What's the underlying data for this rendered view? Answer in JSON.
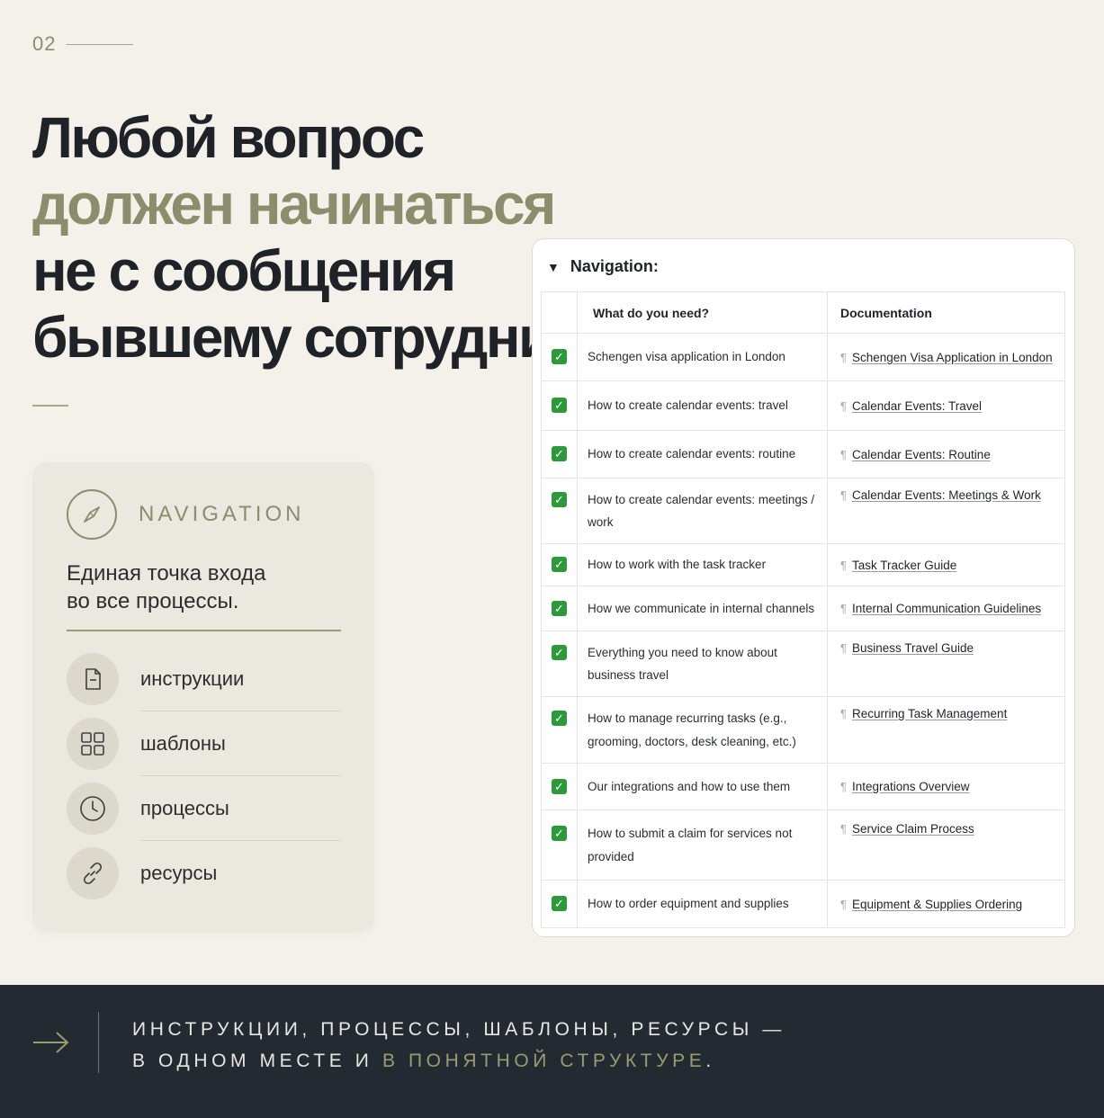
{
  "page_number": "02",
  "headline": {
    "line1": "Любой вопрос",
    "line2": "должен начинаться",
    "line3": "не с сообщения",
    "line4": "бывшему сотруднику."
  },
  "card": {
    "icon": "compass-icon",
    "title": "NAVIGATION",
    "subtitle_line1": "Единая точка входа",
    "subtitle_line2": "во все процессы.",
    "items": [
      {
        "icon": "document-icon",
        "label": "инструкции"
      },
      {
        "icon": "grid-icon",
        "label": "шаблоны"
      },
      {
        "icon": "clock-icon",
        "label": "процессы"
      },
      {
        "icon": "link-icon",
        "label": "ресурсы"
      }
    ]
  },
  "panel": {
    "title": "Navigation:",
    "columns": [
      "What do you need?",
      "Documentation"
    ],
    "rows": [
      {
        "question": "Schengen visa application in London",
        "doc": "Schengen Visa Application in London"
      },
      {
        "question": "How to create calendar events: travel",
        "doc": "Calendar Events: Travel"
      },
      {
        "question": "How to create calendar events: routine",
        "doc": "Calendar Events: Routine"
      },
      {
        "question": "How to create calendar events: meetings / work",
        "doc": "Calendar Events: Meetings & Work"
      },
      {
        "question": "How to work with the task tracker",
        "doc": "Task Tracker Guide"
      },
      {
        "question": "How we communicate in internal channels",
        "doc": "Internal Communication Guidelines"
      },
      {
        "question": "Everything you need to know about business travel",
        "doc": "Business Travel Guide"
      },
      {
        "question": "How to manage recurring tasks (e.g., grooming, doctors, desk cleaning, etc.)",
        "doc": "Recurring Task Management"
      },
      {
        "question": "Our integrations and how to use them",
        "doc": "Integrations Overview"
      },
      {
        "question": "How to submit a claim for services not provided",
        "doc": "Service Claim Process"
      },
      {
        "question": "How to order equipment and supplies",
        "doc": "Equipment & Supplies Ordering"
      }
    ]
  },
  "footer": {
    "line1": "ИНСТРУКЦИИ, ПРОЦЕССЫ, ШАБЛОНЫ, РЕСУРСЫ —",
    "line2_plain": "В ОДНОМ МЕСТЕ И ",
    "line2_accent": "В ПОНЯТНОЙ СТРУКТУРЕ",
    "line2_end": "."
  },
  "colors": {
    "background": "#f4f1ea",
    "accent_olive": "#8b8d6c",
    "footer_bg": "#232a31",
    "checkbox_green": "#2c9a3a"
  }
}
